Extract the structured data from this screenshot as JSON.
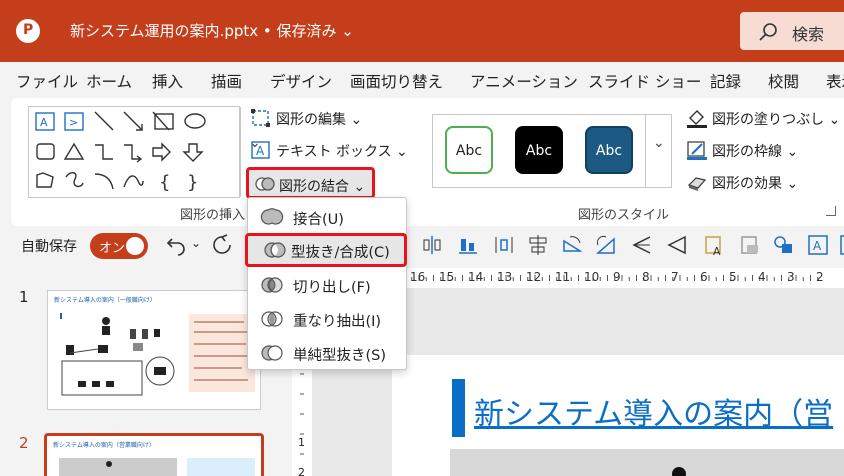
{
  "window": {
    "title": "新システム運用の案内.pptx • 保存済み ⌄",
    "search_label": "検索",
    "brand_color": "#c43e1c"
  },
  "tabs": [
    "ファイル",
    "ホーム",
    "挿入",
    "描画",
    "デザイン",
    "画面切り替え",
    "アニメーション",
    "スライド ショー",
    "記録",
    "校閲",
    "表示"
  ],
  "ribbon": {
    "insert_shapes_group": "図形の挿入",
    "edit_shape": "図形の編集 ⌄",
    "text_box": "テキスト ボックス  ⌄",
    "merge_shapes": "図形の結合 ⌄",
    "styles_group": "図形のスタイル",
    "style_swatches": [
      {
        "label": "Abc",
        "fill": "#ffffff",
        "border": "#4caf50",
        "text": "#222222"
      },
      {
        "label": "Abc",
        "fill": "#000000",
        "border": "#000000",
        "text": "#ffffff"
      },
      {
        "label": "Abc",
        "fill": "#1c5a84",
        "border": "#123f5e",
        "text": "#ffffff"
      }
    ],
    "fill": "図形の塗りつぶし ⌄",
    "outline": "図形の枠線 ⌄",
    "effects": "図形の効果 ⌄"
  },
  "qat": {
    "autosave_label": "自動保存",
    "toggle_label": "オン"
  },
  "merge_menu": {
    "items": [
      "接合(U)",
      "型抜き/合成(C)",
      "切り出し(F)",
      "重なり抽出(I)",
      "単純型抜き(S)"
    ],
    "highlighted_index": 1
  },
  "slides_pane": {
    "slide_numbers": [
      "1",
      "2"
    ],
    "slide1_thumb_title": "新システム導入の案内（一般職向け）",
    "slide2_thumb_title": "新システム導入の案内（営業職向け）"
  },
  "ruler": {
    "h_labels": [
      "16",
      "15",
      "14",
      "13",
      "12",
      "11",
      "10",
      "9",
      "8",
      "7",
      "6",
      "5",
      "4",
      "3",
      "2",
      "1"
    ],
    "v_labels": [
      "1",
      "2"
    ]
  },
  "slide": {
    "title": "新システム導入の案内（営"
  }
}
